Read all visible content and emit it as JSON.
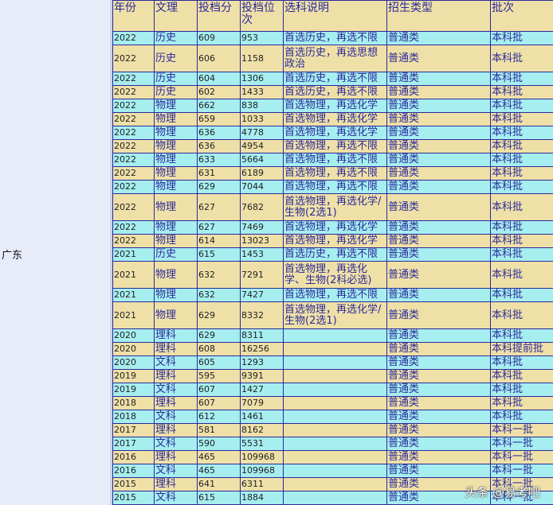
{
  "province": "广东",
  "headers": {
    "year": "年份",
    "wenli": "文理",
    "score": "投档分",
    "rank": "投档位次",
    "desc": "选科说明",
    "type": "招生类型",
    "batch": "批次"
  },
  "rows": [
    {
      "year": "2022",
      "wenli": "历史",
      "score": "609",
      "rank": "953",
      "desc": "首选历史，再选不限",
      "type": "普通类",
      "batch": "本科批"
    },
    {
      "year": "2022",
      "wenli": "历史",
      "score": "606",
      "rank": "1158",
      "desc": "首选历史，再选思想政治",
      "type": "普通类",
      "batch": "本科批"
    },
    {
      "year": "2022",
      "wenli": "历史",
      "score": "604",
      "rank": "1306",
      "desc": "首选历史，再选不限",
      "type": "普通类",
      "batch": "本科批"
    },
    {
      "year": "2022",
      "wenli": "历史",
      "score": "602",
      "rank": "1433",
      "desc": "首选历史，再选不限",
      "type": "普通类",
      "batch": "本科批"
    },
    {
      "year": "2022",
      "wenli": "物理",
      "score": "662",
      "rank": "838",
      "desc": "首选物理，再选化学",
      "type": "普通类",
      "batch": "本科批"
    },
    {
      "year": "2022",
      "wenli": "物理",
      "score": "659",
      "rank": "1033",
      "desc": "首选物理，再选化学",
      "type": "普通类",
      "batch": "本科批"
    },
    {
      "year": "2022",
      "wenli": "物理",
      "score": "636",
      "rank": "4778",
      "desc": "首选物理，再选化学",
      "type": "普通类",
      "batch": "本科批"
    },
    {
      "year": "2022",
      "wenli": "物理",
      "score": "636",
      "rank": "4954",
      "desc": "首选物理，再选不限",
      "type": "普通类",
      "batch": "本科批"
    },
    {
      "year": "2022",
      "wenli": "物理",
      "score": "633",
      "rank": "5664",
      "desc": "首选物理，再选不限",
      "type": "普通类",
      "batch": "本科批"
    },
    {
      "year": "2022",
      "wenli": "物理",
      "score": "631",
      "rank": "6189",
      "desc": "首选物理，再选不限",
      "type": "普通类",
      "batch": "本科批"
    },
    {
      "year": "2022",
      "wenli": "物理",
      "score": "629",
      "rank": "7044",
      "desc": "首选物理，再选不限",
      "type": "普通类",
      "batch": "本科批"
    },
    {
      "year": "2022",
      "wenli": "物理",
      "score": "627",
      "rank": "7682",
      "desc": "首选物理，再选化学/生物(2选1)",
      "type": "普通类",
      "batch": "本科批"
    },
    {
      "year": "2022",
      "wenli": "物理",
      "score": "627",
      "rank": "7469",
      "desc": "首选物理，再选化学",
      "type": "普通类",
      "batch": "本科批"
    },
    {
      "year": "2022",
      "wenli": "物理",
      "score": "614",
      "rank": "13023",
      "desc": "首选物理，再选化学",
      "type": "普通类",
      "batch": "本科批"
    },
    {
      "year": "2021",
      "wenli": "历史",
      "score": "615",
      "rank": "1453",
      "desc": "首选历史，再选不限",
      "type": "普通类",
      "batch": "本科批"
    },
    {
      "year": "2021",
      "wenli": "物理",
      "score": "632",
      "rank": "7291",
      "desc": "首选物理，再选化学、生物(2科必选)",
      "type": "普通类",
      "batch": "本科批"
    },
    {
      "year": "2021",
      "wenli": "物理",
      "score": "632",
      "rank": "7427",
      "desc": "首选物理，再选不限",
      "type": "普通类",
      "batch": "本科批"
    },
    {
      "year": "2021",
      "wenli": "物理",
      "score": "629",
      "rank": "8332",
      "desc": "首选物理，再选化学/生物(2选1)",
      "type": "普通类",
      "batch": "本科批"
    },
    {
      "year": "2020",
      "wenli": "理科",
      "score": "629",
      "rank": "8311",
      "desc": "",
      "type": "普通类",
      "batch": "本科批"
    },
    {
      "year": "2020",
      "wenli": "理科",
      "score": "608",
      "rank": "16256",
      "desc": "",
      "type": "普通类",
      "batch": "本科提前批"
    },
    {
      "year": "2020",
      "wenli": "文科",
      "score": "605",
      "rank": "1293",
      "desc": "",
      "type": "普通类",
      "batch": "本科批"
    },
    {
      "year": "2019",
      "wenli": "理科",
      "score": "595",
      "rank": "9391",
      "desc": "",
      "type": "普通类",
      "batch": "本科批"
    },
    {
      "year": "2019",
      "wenli": "文科",
      "score": "607",
      "rank": "1427",
      "desc": "",
      "type": "普通类",
      "batch": "本科批"
    },
    {
      "year": "2018",
      "wenli": "理科",
      "score": "607",
      "rank": "7079",
      "desc": "",
      "type": "普通类",
      "batch": "本科批"
    },
    {
      "year": "2018",
      "wenli": "文科",
      "score": "612",
      "rank": "1461",
      "desc": "",
      "type": "普通类",
      "batch": "本科批"
    },
    {
      "year": "2017",
      "wenli": "理科",
      "score": "581",
      "rank": "8162",
      "desc": "",
      "type": "普通类",
      "batch": "本科一批"
    },
    {
      "year": "2017",
      "wenli": "文科",
      "score": "590",
      "rank": "5531",
      "desc": "",
      "type": "普通类",
      "batch": "本科一批"
    },
    {
      "year": "2016",
      "wenli": "理科",
      "score": "465",
      "rank": "109968",
      "desc": "",
      "type": "普通类",
      "batch": "本科一批"
    },
    {
      "year": "2016",
      "wenli": "文科",
      "score": "465",
      "rank": "109968",
      "desc": "",
      "type": "普通类",
      "batch": "本科一批"
    },
    {
      "year": "2015",
      "wenli": "理科",
      "score": "641",
      "rank": "6311",
      "desc": "",
      "type": "普通类",
      "batch": "本科一批"
    },
    {
      "year": "2015",
      "wenli": "文科",
      "score": "615",
      "rank": "1884",
      "desc": "",
      "type": "普通类",
      "batch": "本科一批"
    }
  ],
  "watermark": "头条 @易考吧"
}
